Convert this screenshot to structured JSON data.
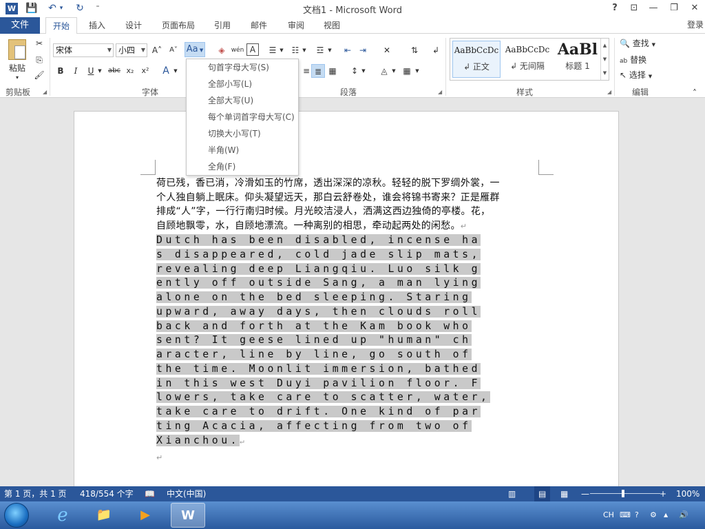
{
  "window": {
    "title": "文档1 - Microsoft Word",
    "help": "?",
    "ribbon_display": "⊡",
    "minimize": "—",
    "restore": "❐",
    "close": "✕"
  },
  "qat": {
    "logo": "W",
    "save": "💾",
    "undo": "↶",
    "undo_arrow": "▾",
    "redo": "↻",
    "customize": "⁼"
  },
  "tabs": {
    "file": "文件",
    "items": [
      "开始",
      "插入",
      "设计",
      "页面布局",
      "引用",
      "邮件",
      "审阅",
      "视图"
    ],
    "active_index": 0,
    "login": "登录"
  },
  "ribbon": {
    "clipboard": {
      "label": "剪贴板",
      "paste": "粘贴",
      "paste_arrow": "▾",
      "cut_icon": "✂",
      "copy_icon": "⎘",
      "painter_icon": "🖌"
    },
    "font": {
      "label": "字体",
      "font_name": "宋体",
      "font_size": "小四",
      "grow": "A˄",
      "shrink": "A˅",
      "change_case": "Aa",
      "clear_format_icon": "◈",
      "phonetic": "wén",
      "char_border": "A",
      "bold": "B",
      "italic": "I",
      "underline": "U",
      "strikethrough": "abc",
      "subscript": "x₂",
      "superscript": "x²",
      "text_effects": "A"
    },
    "paragraph": {
      "label": "段落"
    },
    "styles": {
      "label": "样式",
      "items": [
        {
          "sample": "AaBbCcDc",
          "name": "↲ 正文"
        },
        {
          "sample": "AaBbCcDc",
          "name": "↲ 无间隔"
        },
        {
          "sample": "AaBl",
          "name": "标题 1"
        }
      ]
    },
    "editing": {
      "label": "编辑",
      "find": "查找",
      "replace": "替换",
      "select": "选择"
    },
    "collapse": "˄"
  },
  "case_menu": {
    "items": [
      "句首字母大写(S)",
      "全部小写(L)",
      "全部大写(U)",
      "每个单词首字母大写(C)",
      "切换大小写(T)",
      "半角(W)",
      "全角(F)"
    ]
  },
  "document": {
    "cn_lines": [
      "荷已残，香已消，冷滑如玉的竹席，透出深深的凉秋。轻轻的脱下罗绸外裳，一",
      "个人独自躺上眠床。仰头凝望远天，那白云舒卷处，谁会将锦书寄来？正是雁群",
      "排成“人”字，一行行南归时候。月光皎洁浸人，洒满这西边独倚的亭楼。花，",
      "自顾地飘零，水，自顾地漂流。一种离别的相思，牵动起两处的闲愁。"
    ],
    "en_lines": [
      "Dutch has been disabled, incense ha",
      "s disappeared, cold jade slip mats,",
      "revealing deep Liangqiu. Luo silk g",
      "ently off outside Sang, a man lying",
      "alone on the bed sleeping. Staring",
      "upward, away days, then clouds roll",
      "back and forth at the Kam book who",
      "sent? It geese lined up \"human\" ch",
      "aracter, line by line, go south of",
      "the time. Moonlit immersion, bathed",
      "in this west Duyi pavilion floor. F",
      "lowers, take care to scatter, water,",
      "take care to drift. One kind of par",
      "ting Acacia, affecting from two of",
      "Xianchou."
    ],
    "pilcrow": "↵"
  },
  "statusbar": {
    "page": "第 1 页，共 1 页",
    "words": "418/554 个字",
    "proof_icon": "📖",
    "language": "中文(中国)",
    "zoom_minus": "—",
    "zoom_plus": "+",
    "zoom": "100%"
  },
  "taskbar": {
    "ie": "e",
    "explorer": "📁",
    "media": "▶",
    "word": "W",
    "ime": "CH",
    "help": "?",
    "tray_arrow": "▲",
    "volume": "🔊"
  }
}
